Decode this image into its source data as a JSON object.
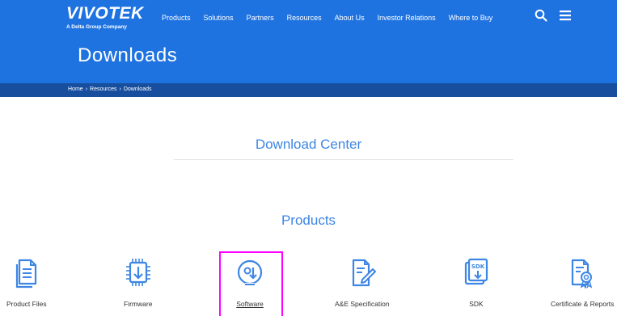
{
  "header": {
    "logo": {
      "name": "VIVOTEK",
      "tagline": "A Delta Group Company"
    },
    "nav": [
      "Products",
      "Solutions",
      "Partners",
      "Resources",
      "About Us",
      "Investor Relations",
      "Where to Buy"
    ],
    "page_title": "Downloads",
    "icons": [
      "search-icon",
      "menu-icon"
    ]
  },
  "breadcrumb": {
    "items": [
      "Home",
      "Resources",
      "Downloads"
    ],
    "separator": "›"
  },
  "main": {
    "download_center_title": "Download Center",
    "products_title": "Products",
    "categories": [
      {
        "label": "Product Files",
        "icon": "document-icon"
      },
      {
        "label": "Firmware",
        "icon": "chip-icon"
      },
      {
        "label": "Software",
        "icon": "disc-download-icon",
        "highlighted": true
      },
      {
        "label": "A&E Specification",
        "icon": "document-pen-icon"
      },
      {
        "label": "SDK",
        "icon": "sdk-icon"
      },
      {
        "label": "Certificate & Reports",
        "icon": "certificate-icon"
      }
    ]
  },
  "colors": {
    "header_blue": "#1f73e0",
    "breadcrumb_blue": "#174f9e",
    "title_blue": "#3d86e3",
    "highlight_magenta": "#ff00ff"
  }
}
